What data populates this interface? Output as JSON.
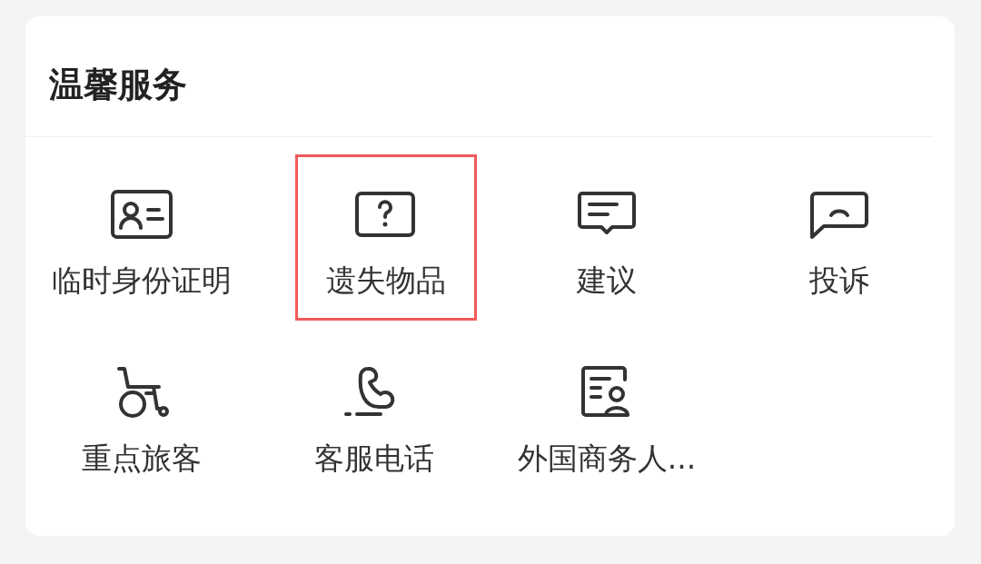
{
  "card": {
    "title": "温馨服务"
  },
  "services": [
    {
      "kind": "id-card",
      "label": "临时身份证明",
      "highlighted": false
    },
    {
      "kind": "question",
      "label": "遗失物品",
      "highlighted": true
    },
    {
      "kind": "message",
      "label": "建议",
      "highlighted": false
    },
    {
      "kind": "complaint",
      "label": "投诉",
      "highlighted": false
    },
    {
      "kind": "wheelchair",
      "label": "重点旅客",
      "highlighted": false
    },
    {
      "kind": "phone",
      "label": "客服电话",
      "highlighted": false
    },
    {
      "kind": "document",
      "label": "外国商务人...",
      "highlighted": false
    }
  ]
}
